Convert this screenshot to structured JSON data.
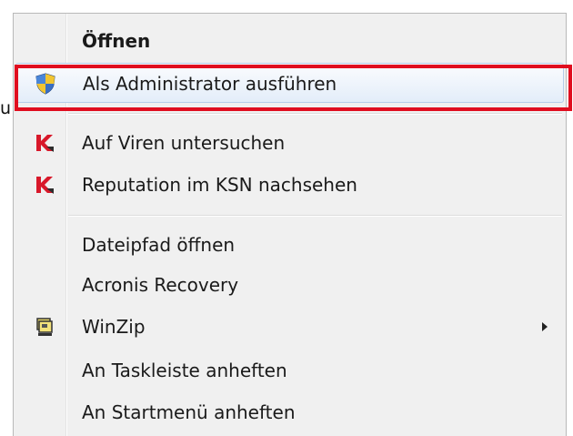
{
  "background_fragment": "u",
  "menu": {
    "items": [
      {
        "label": "Öffnen",
        "icon": ""
      },
      {
        "label": "Als Administrator ausführen",
        "icon": "uac-shield-icon"
      },
      {
        "label": "Auf Viren untersuchen",
        "icon": "kaspersky-icon"
      },
      {
        "label": "Reputation im KSN nachsehen",
        "icon": "kaspersky-icon"
      },
      {
        "label": "Dateipfad öffnen",
        "icon": ""
      },
      {
        "label": "Acronis Recovery",
        "icon": ""
      },
      {
        "label": "WinZip",
        "icon": "winzip-icon",
        "has_submenu": true
      },
      {
        "label": "An Taskleiste anheften",
        "icon": ""
      },
      {
        "label": "An Startmenü anheften",
        "icon": ""
      }
    ]
  },
  "colors": {
    "highlight_border": "#e00d1f",
    "menu_background": "#f0f0f0",
    "hover_background": "#e3edf9"
  }
}
